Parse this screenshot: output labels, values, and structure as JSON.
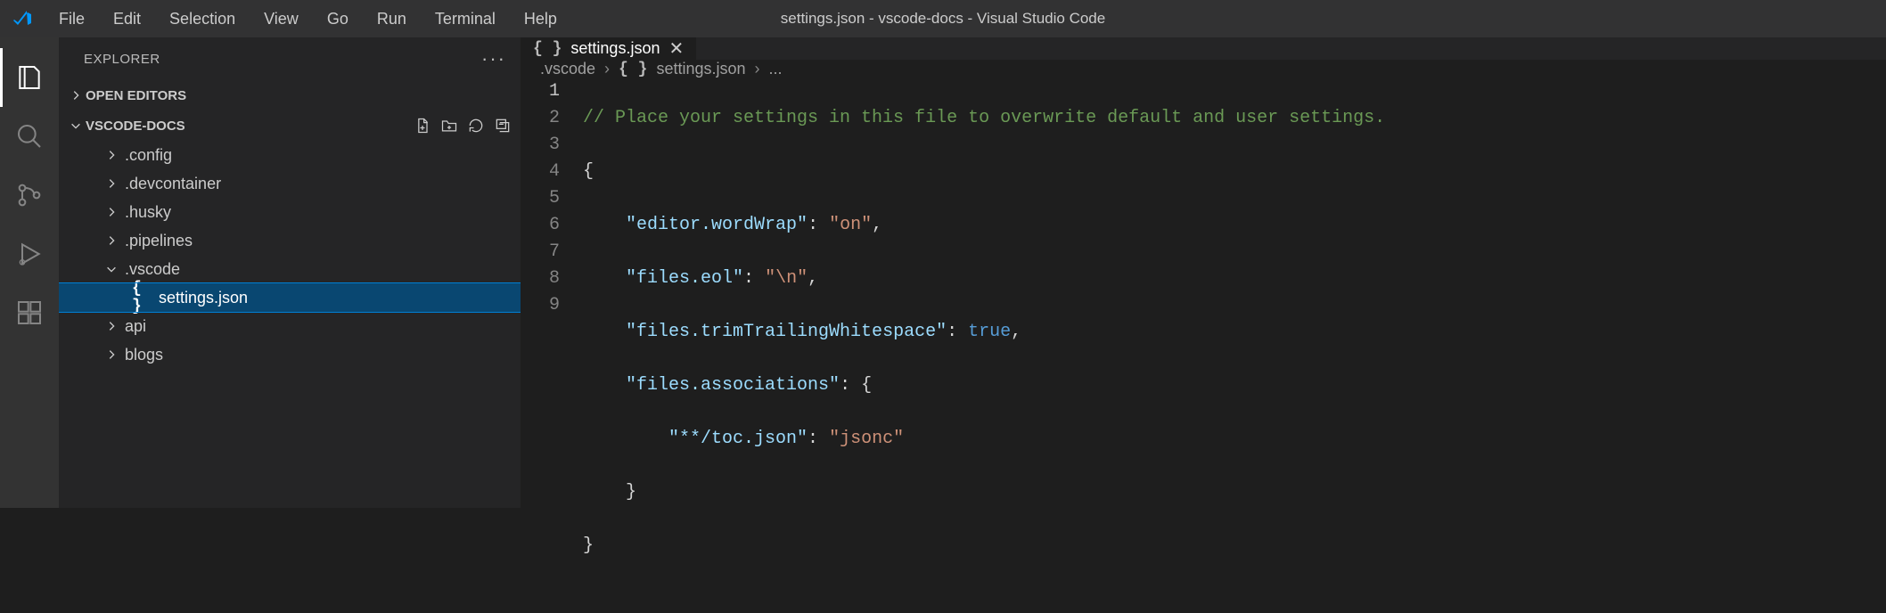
{
  "title": "settings.json - vscode-docs - Visual Studio Code",
  "menubar": [
    "File",
    "Edit",
    "Selection",
    "View",
    "Go",
    "Run",
    "Terminal",
    "Help"
  ],
  "sidebar": {
    "title": "EXPLORER",
    "open_editors_label": "OPEN EDITORS",
    "folder_label": "VSCODE-DOCS",
    "tree": [
      {
        "name": ".config",
        "type": "folder",
        "depth": 1
      },
      {
        "name": ".devcontainer",
        "type": "folder",
        "depth": 1
      },
      {
        "name": ".husky",
        "type": "folder",
        "depth": 1
      },
      {
        "name": ".pipelines",
        "type": "folder",
        "depth": 1
      },
      {
        "name": ".vscode",
        "type": "folder",
        "depth": 1,
        "expanded": true
      },
      {
        "name": "settings.json",
        "type": "file",
        "depth": 2,
        "selected": true
      },
      {
        "name": "api",
        "type": "folder",
        "depth": 1
      },
      {
        "name": "blogs",
        "type": "folder",
        "depth": 1
      }
    ]
  },
  "tab": {
    "label": "settings.json"
  },
  "breadcrumbs": {
    "parts": [
      ".vscode",
      "settings.json",
      "..."
    ]
  },
  "editor": {
    "line_numbers": [
      1,
      2,
      3,
      4,
      5,
      6,
      7,
      8,
      9
    ],
    "current_line": 1,
    "comment": "// Place your settings in this file to overwrite default and user settings.",
    "kv": {
      "wordWrap_key": "\"editor.wordWrap\"",
      "wordWrap_val": "\"on\"",
      "eol_key": "\"files.eol\"",
      "eol_val": "\"\\n\"",
      "trim_key": "\"files.trimTrailingWhitespace\"",
      "trim_val": "true",
      "assoc_key": "\"files.associations\"",
      "toc_key": "\"**/toc.json\"",
      "toc_val": "\"jsonc\""
    }
  }
}
